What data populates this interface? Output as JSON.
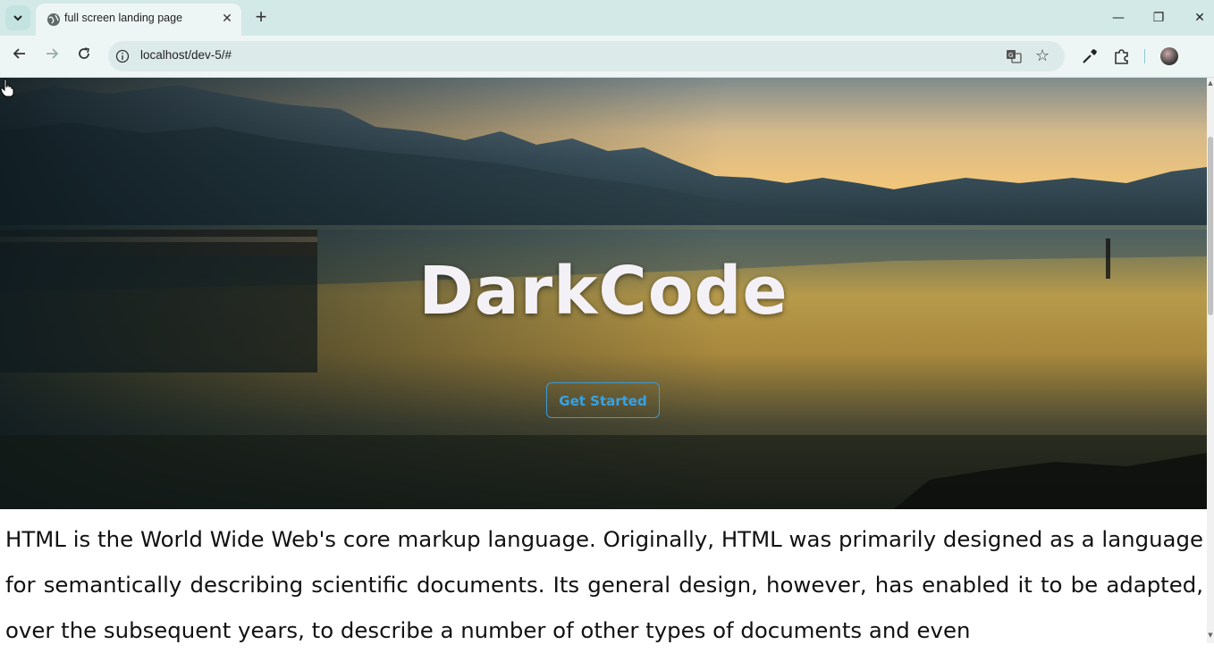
{
  "browser": {
    "tab_title": "full screen landing page",
    "url": "localhost/dev-5/#",
    "new_tab_label": "+",
    "close_tab_label": "✕",
    "minimize_label": "—",
    "restore_label": "❐",
    "close_window_label": "✕"
  },
  "hero": {
    "title": "DarkCode",
    "cta_label": "Get Started",
    "accent": "#38a2e3"
  },
  "content": {
    "paragraph": "HTML is the World Wide Web's core markup language. Originally, HTML was primarily designed as a language for semantically describing scientific documents. Its general design, however, has enabled it to be adapted, over the subsequent years, to describe a number of other types of documents and even"
  }
}
